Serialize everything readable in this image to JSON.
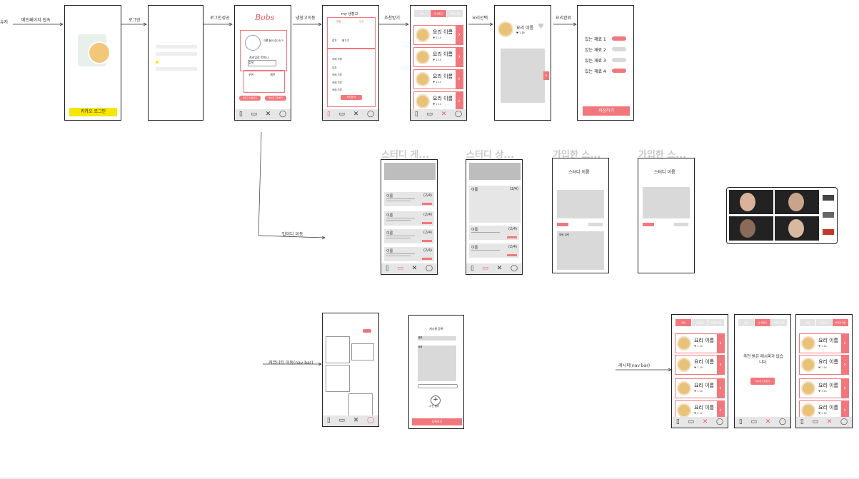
{
  "actor": "유저",
  "steps": {
    "s1": "메인페이지 접속",
    "s2": "로그인",
    "s3": "로그인성공",
    "s4": "냉장고이동",
    "s5": "추천받기",
    "s6": "요리선택",
    "s7": "요리완료",
    "study_move": "밥이디 이동",
    "community_move": "커뮤니티 이동(nav bar)",
    "recipe_move": "레시피(nav bar)"
  },
  "login": {
    "kakao": "카카오 로그인"
  },
  "home": {
    "logo": "Bobs",
    "profile_name": "이름 들어 감(닉) ✎",
    "section": "최초입장 컨피시",
    "search": "검색",
    "milk": "우유",
    "egg": "계란",
    "btn_left": "냉장고 이동하기",
    "btn_right": "레시피 추천받기"
  },
  "fridge": {
    "title": "my 냉장고",
    "tab1": "냉동",
    "tab2": "냉장",
    "items": [
      "감자",
      "돼고기"
    ],
    "drop": "냉장 재료",
    "list": [
      "카레 가루",
      "감자",
      "카레 가루",
      "카레 가루",
      "카레 가루"
    ],
    "btn": "추천받기"
  },
  "recipe": {
    "tabs": [
      "전체",
      "내 냉장고",
      "부족한 재료"
    ],
    "card_title": "요리 이름",
    "card_sub": "♥ 1.1k"
  },
  "detail": {
    "title": "요리 이름",
    "sub": "♥ 1.1k"
  },
  "done": {
    "items": [
      "있는 재료 1",
      "있는 재료 2",
      "있는 재료 3",
      "있는 재료 4"
    ],
    "save": "저장하기"
  },
  "study": {
    "titles": [
      "스터디 게...",
      "스터디 상...",
      "가입한 스...",
      "가입한 스..."
    ],
    "card_name": "이름",
    "card_count": "(2/4)",
    "study_title": "스터디 이름",
    "chat": "채팅 입력"
  },
  "community": {
    "title": "게시물 등록",
    "field_title": "제목",
    "field_body": "내용",
    "photo": "사진 첨부",
    "submit": "등록하기"
  },
  "empty": {
    "msg": "추천 받은 레시피가 없습니다.",
    "btn": "레시피 추천받기"
  }
}
